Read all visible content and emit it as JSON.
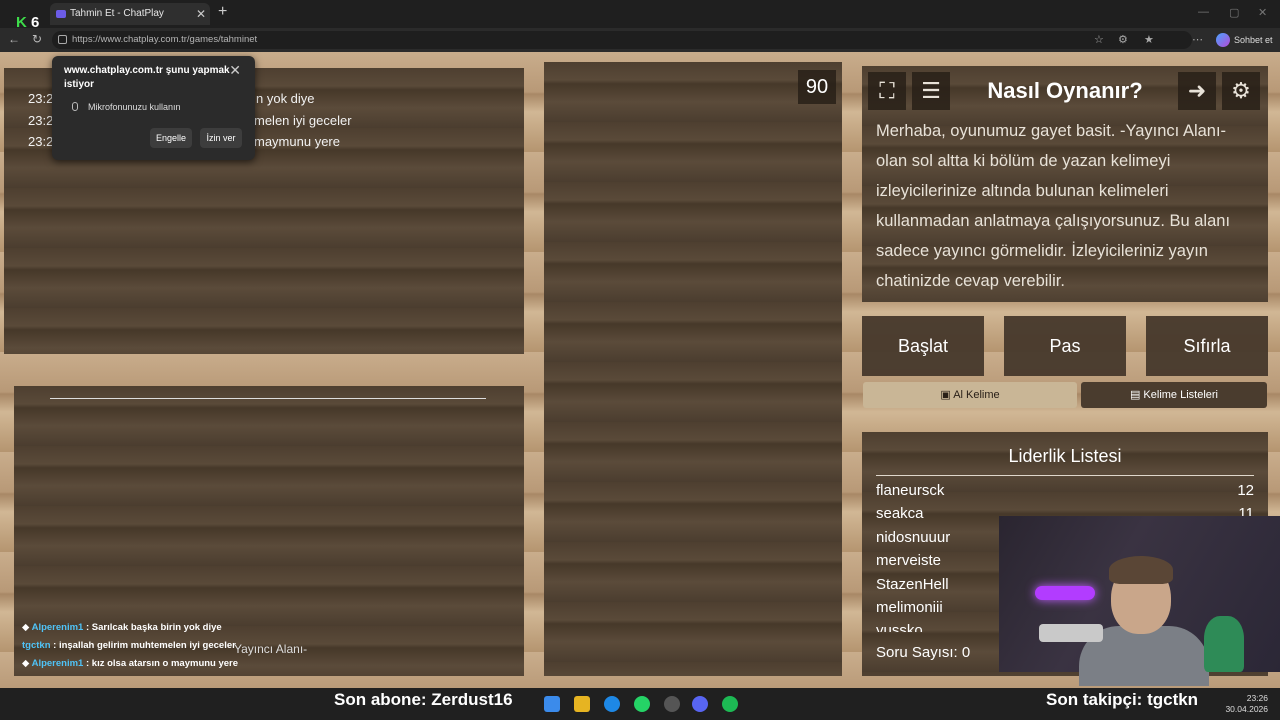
{
  "browser": {
    "tab_title": "Tahmin Et - ChatPlay",
    "url": "https://www.chatplay.com.tr/games/tahminet",
    "overlay_badge": "6",
    "overlay_k": "K",
    "profile_label": "Sohbet et"
  },
  "permission_popup": {
    "title": "www.chatplay.com.tr şunu yapmak istiyor",
    "permission": "Mikrofonunuzu kullanın",
    "block_label": "Engelle",
    "allow_label": "İzin ver"
  },
  "chat_overlay": {
    "lines": [
      {
        "time": "23:2",
        "text": "n yok diye"
      },
      {
        "time": "23:2",
        "text": "melen iyi geceler"
      },
      {
        "time": "23:2",
        "text": "maymunu yere"
      }
    ]
  },
  "game": {
    "timer": "90",
    "how_to_title": "Nasıl Oynanır?",
    "how_to_text": "Merhaba, oyunumuz gayet basit. -Yayıncı Alanı- olan sol altta ki bölüm de yazan kelimeyi izleyicilerinize altında bulunan kelimeleri kullanmadan anlatmaya çalışıyorsunuz. Bu alanı sadece yayıncı görmelidir. İzleyicileriniz yayın chatinizde cevap verebilir.",
    "buttons": {
      "start": "Başlat",
      "pass": "Pas",
      "reset": "Sıfırla"
    },
    "tabs": {
      "get_word": "Al Kelime",
      "word_lists": "Kelime Listeleri"
    },
    "streamer_area_label": "Yayıncı Alanı-",
    "leaderboard": {
      "title": "Liderlik Listesi",
      "rows": [
        {
          "name": "flaneursck",
          "score": "12"
        },
        {
          "name": "seakca",
          "score": "11"
        },
        {
          "name": "nidosnuuur",
          "score": ""
        },
        {
          "name": "merveiste",
          "score": ""
        },
        {
          "name": "StazenHell",
          "score": ""
        },
        {
          "name": "melimoniii",
          "score": ""
        },
        {
          "name": "yussko",
          "score": ""
        }
      ],
      "question_count": "Soru Sayısı: 0"
    }
  },
  "twitch_chat": [
    {
      "user": "Alperenim1",
      "text": ": Sarılcak başka birin yok diye"
    },
    {
      "user": "tgctkn",
      "text": ": inşallah gelirim muhtemelen iyi geceler"
    },
    {
      "user": "Alperenim1",
      "text": ": kız olsa atarsın o maymunu yere"
    }
  ],
  "stream_overlay": {
    "last_sub": "Son abone: Zerdust16",
    "last_follower": "Son takipçi: tgctkn"
  },
  "taskbar": {
    "time": "23:26",
    "date": "30.04.2026"
  },
  "colors": {
    "wood_dark": "#4e3f30",
    "wood_light": "#c9ad8c",
    "tab_active": "#c9b696",
    "accent_twitch_user": "#4fc3f7"
  }
}
